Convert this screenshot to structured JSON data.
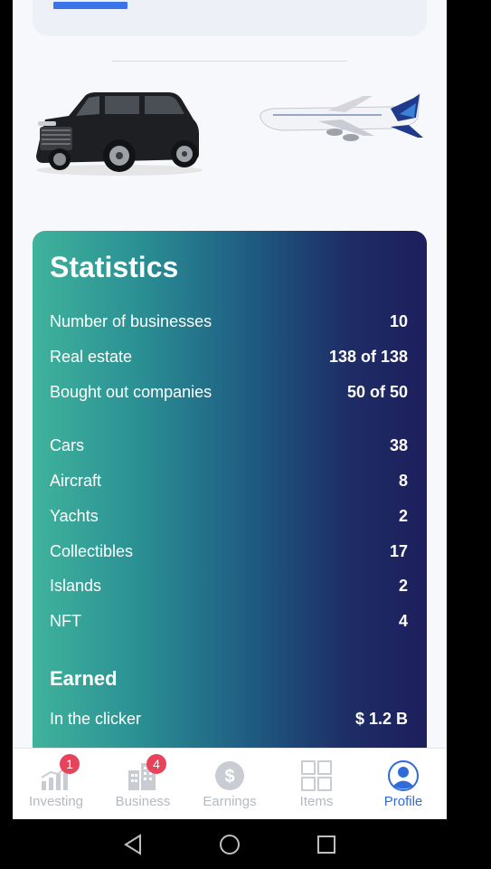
{
  "statistics": {
    "title": "Statistics",
    "rows": [
      {
        "label": "Number of businesses",
        "value": "10"
      },
      {
        "label": "Real estate",
        "value": "138 of 138"
      },
      {
        "label": "Bought out companies",
        "value": "50 of 50"
      },
      {
        "label": "Cars",
        "value": "38"
      },
      {
        "label": "Aircraft",
        "value": "8"
      },
      {
        "label": "Yachts",
        "value": "2"
      },
      {
        "label": "Collectibles",
        "value": "17"
      },
      {
        "label": "Islands",
        "value": "2"
      },
      {
        "label": "NFT",
        "value": "4"
      }
    ],
    "earned_title": "Earned",
    "earned_rows": [
      {
        "label": "In the clicker",
        "value": "$ 1.2 B"
      }
    ]
  },
  "nav": {
    "items": [
      {
        "label": "Investing",
        "icon": "bar-chart-icon",
        "badge": "1"
      },
      {
        "label": "Business",
        "icon": "building-icon",
        "badge": "4"
      },
      {
        "label": "Earnings",
        "icon": "dollar-icon"
      },
      {
        "label": "Items",
        "icon": "grid-icon"
      },
      {
        "label": "Profile",
        "icon": "user-icon",
        "active": true
      }
    ]
  },
  "colors": {
    "accent": "#2f6bd9",
    "badge": "#e9435b",
    "gradient_start": "#3fb39c",
    "gradient_end": "#1d1f5c"
  }
}
